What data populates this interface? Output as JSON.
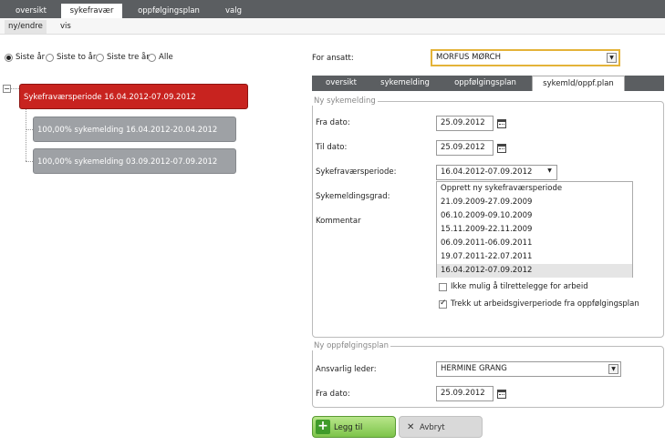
{
  "top_tabs": [
    "oversikt",
    "sykefravær",
    "oppfølgingsplan",
    "valg"
  ],
  "sub_tabs": [
    "ny/endre",
    "vis"
  ],
  "period_filter": {
    "options": [
      "Siste år",
      "Siste to år",
      "Siste tre år",
      "Alle"
    ],
    "selected": "Siste år"
  },
  "tree": {
    "toggle": "−",
    "root": "Sykefraværsperiode 16.04.2012-07.09.2012",
    "children": [
      "100,00% sykemelding 16.04.2012-20.04.2012",
      "100,00% sykemelding 03.09.2012-07.09.2012"
    ]
  },
  "ansatt": {
    "label": "For ansatt:",
    "value": "MORFUS MØRCH"
  },
  "right_tabs": [
    "oversikt",
    "sykemelding",
    "oppfølgingsplan",
    "sykemld/oppf.plan"
  ],
  "ny_sykemelding": {
    "legend": "Ny sykemelding",
    "fra_label": "Fra dato:",
    "fra_value": "25.09.2012",
    "til_label": "Til dato:",
    "til_value": "25.09.2012",
    "periode_label": "Sykefraværsperiode:",
    "periode_value": "16.04.2012-07.09.2012",
    "grad_label": "Sykemeldingsgrad:",
    "kommentar_label": "Kommentar",
    "periode_options": [
      "Opprett ny sykefraværsperiode",
      "21.09.2009-27.09.2009",
      "06.10.2009-09.10.2009",
      "15.11.2009-22.11.2009",
      "06.09.2011-06.09.2011",
      "19.07.2011-22.07.2011",
      "16.04.2012-07.09.2012"
    ],
    "check_ikke_mulig": "Ikke mulig å tilrettelegge for arbeid",
    "check_trekk_ut": "Trekk ut arbeidsgiverperiode fra oppfølgingsplan"
  },
  "ny_oppfolgingsplan": {
    "legend": "Ny oppfølgingsplan",
    "leder_label": "Ansvarlig leder:",
    "leder_value": "HERMINE GRANG",
    "fra_label": "Fra dato:",
    "fra_value": "25.09.2012"
  },
  "buttons": {
    "add": "Legg til",
    "cancel": "Avbryt"
  }
}
